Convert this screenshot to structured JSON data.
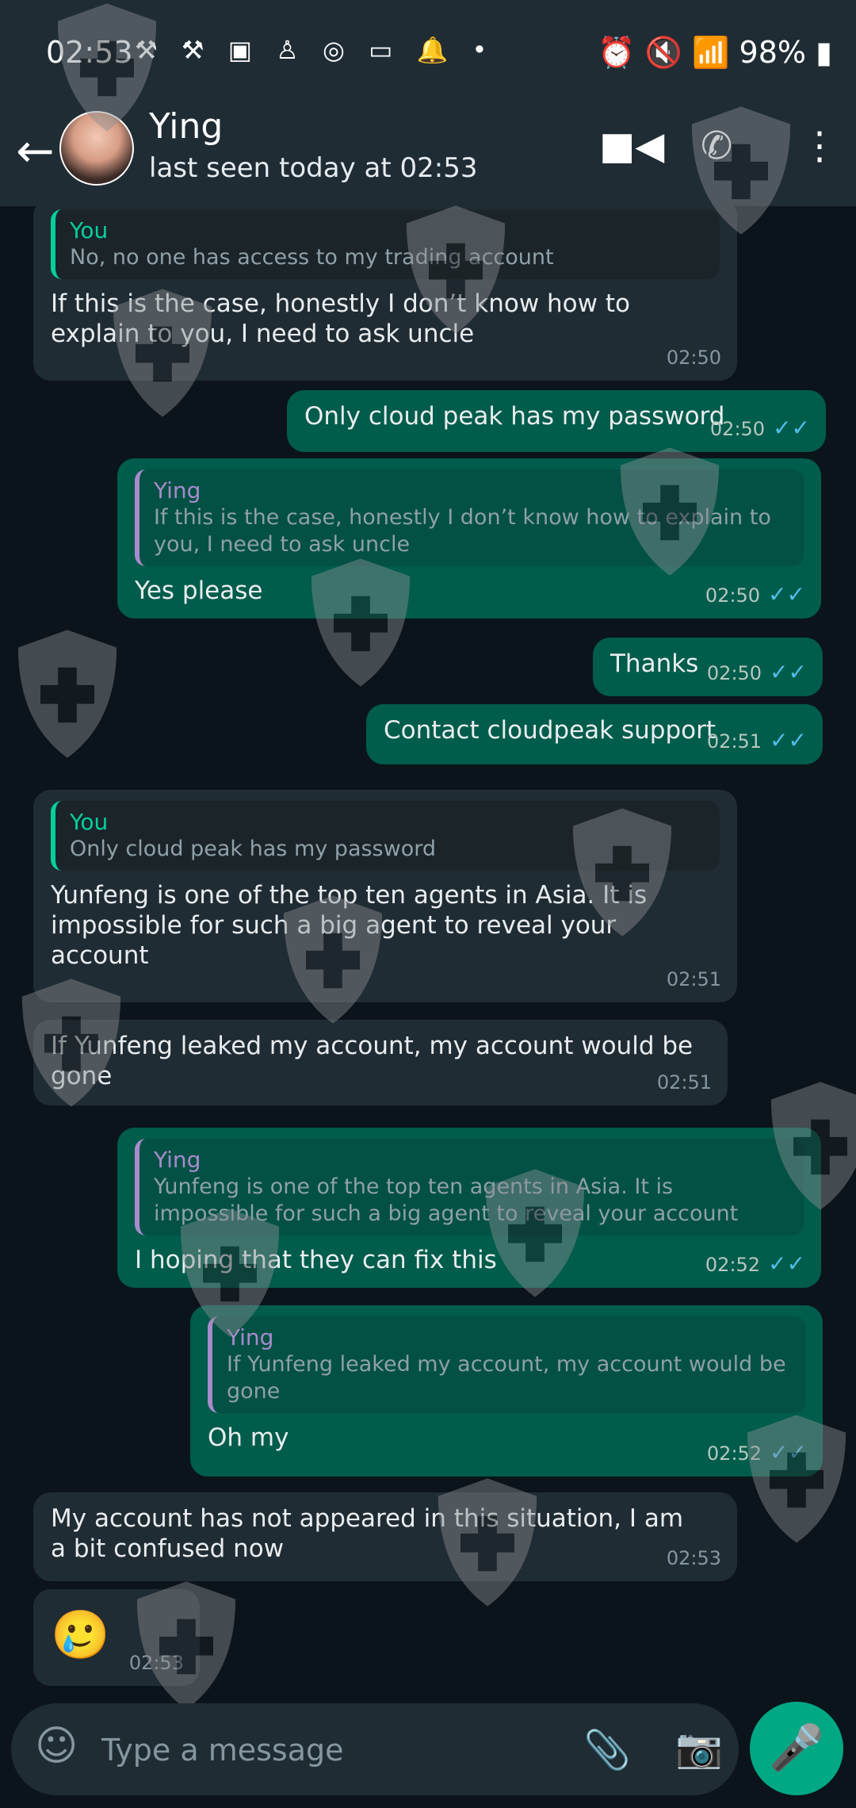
{
  "status": {
    "time": "02:53",
    "battery": "98%"
  },
  "header": {
    "name": "Ying",
    "last_seen": "last seen today at 02:53"
  },
  "messages": [
    {
      "dir": "in",
      "quote_author": "You",
      "quote_text": "No, no one has access to my trading account",
      "text": "If this is the case, honestly I don’t know how to explain to you, I need to ask uncle",
      "time": "02:50"
    },
    {
      "dir": "out",
      "text": "Only cloud peak has my password",
      "time": "02:50"
    },
    {
      "dir": "out",
      "quote_author": "Ying",
      "quote_text": "If this is the case, honestly I don’t know how to explain to you, I need to ask uncle",
      "text": "Yes please",
      "time": "02:50"
    },
    {
      "dir": "out",
      "text": "Thanks",
      "time": "02:50"
    },
    {
      "dir": "out",
      "text": "Contact cloudpeak support",
      "time": "02:51"
    },
    {
      "dir": "in",
      "quote_author": "You",
      "quote_text": "Only cloud peak has my password",
      "text": "Yunfeng is one of the top ten agents in Asia. It is impossible for such a big agent to reveal your account",
      "time": "02:51"
    },
    {
      "dir": "in",
      "text": "If Yunfeng leaked my account, my account would be gone",
      "time": "02:51"
    },
    {
      "dir": "out",
      "quote_author": "Ying",
      "quote_text": "Yunfeng is one of the top ten agents in Asia. It is impossible for such a big agent to reveal your account",
      "text": "I hoping that they can fix this",
      "time": "02:52"
    },
    {
      "dir": "out",
      "quote_author": "Ying",
      "quote_text": "If Yunfeng leaked my account, my account would be gone",
      "text": "Oh my",
      "time": "02:52"
    },
    {
      "dir": "in",
      "text": "My account has not appeared in this situation, I am a bit confused now",
      "time": "02:53"
    },
    {
      "dir": "in",
      "text": "🥲",
      "time": "02:53"
    }
  ],
  "input": {
    "placeholder": "Type a message"
  },
  "icons": [
    "back-arrow-icon",
    "video-call-icon",
    "voice-call-icon",
    "more-options-icon",
    "emoji-icon",
    "attach-icon",
    "camera-icon",
    "mic-icon",
    "read-ticks-icon",
    "shield-watermark-icon"
  ],
  "colors": {
    "chat_bg": "#0b141a",
    "header_bg": "#1f2c34",
    "incoming": "#202c33",
    "outgoing": "#005c4b",
    "accent": "#00a884",
    "ticks": "#53bdeb"
  }
}
